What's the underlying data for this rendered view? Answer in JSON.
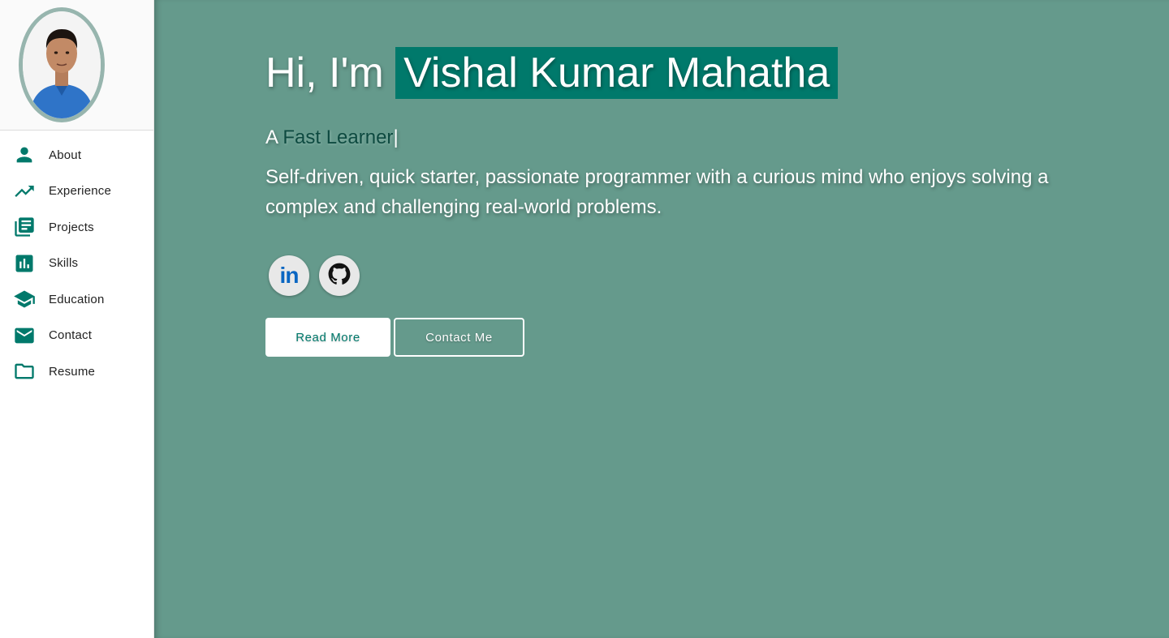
{
  "sidebar": {
    "items": [
      {
        "label": "About",
        "icon": "person-icon"
      },
      {
        "label": "Experience",
        "icon": "trending-up-icon"
      },
      {
        "label": "Projects",
        "icon": "library-books-icon"
      },
      {
        "label": "Skills",
        "icon": "bar-chart-icon"
      },
      {
        "label": "Education",
        "icon": "school-icon"
      },
      {
        "label": "Contact",
        "icon": "mail-icon"
      },
      {
        "label": "Resume",
        "icon": "folder-icon"
      }
    ]
  },
  "hero": {
    "greeting": "Hi, I'm",
    "name": "Vishal Kumar Mahatha",
    "typing_prefix": "A",
    "typing_word": "Fast Learner",
    "typing_cursor": "|",
    "bio": "Self-driven, quick starter, passionate programmer with a curious mind who enjoys solving a complex and challenging real-world problems.",
    "socials": [
      {
        "label": "in",
        "icon": "linkedin-icon"
      },
      {
        "icon": "github-icon"
      }
    ],
    "read_more_label": "Read More",
    "contact_label": "Contact Me"
  },
  "colors": {
    "accent": "#00796b",
    "background": "#659a8c",
    "avatar_border": "#97b5ae"
  }
}
